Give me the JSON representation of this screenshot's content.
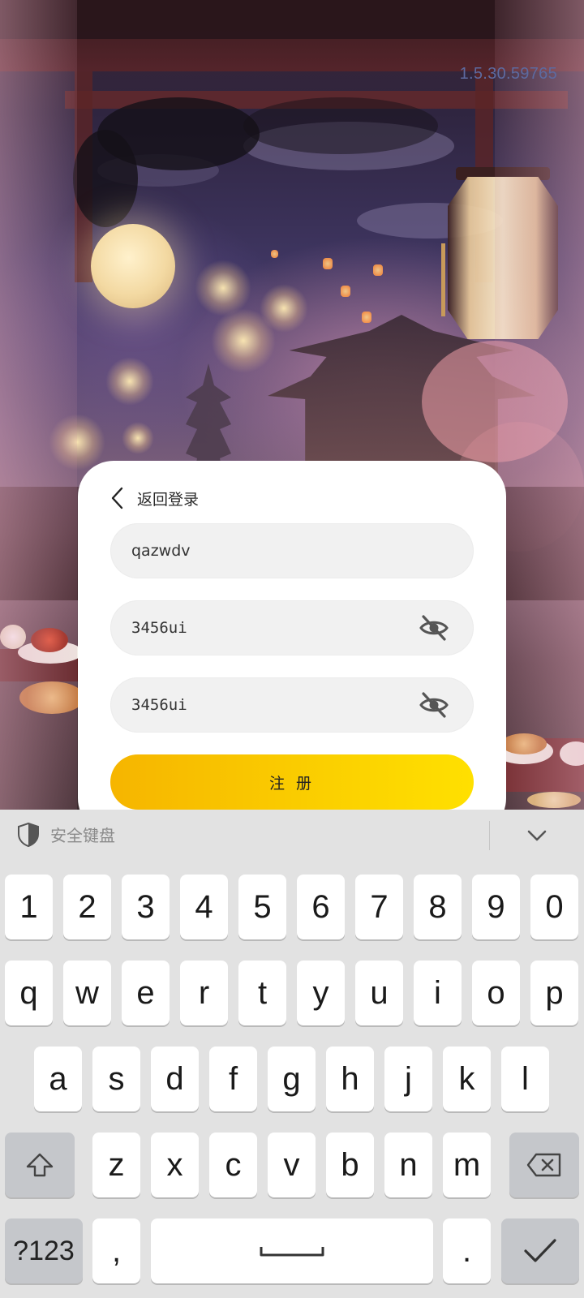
{
  "app": {
    "version": "1.5.30.59765"
  },
  "register_form": {
    "back_label": "返回登录",
    "username_value": "qazwdv",
    "password_value": "3456ui",
    "confirm_password_value": "3456ui",
    "register_button_label": "注 册"
  },
  "keyboard": {
    "title": "安全键盘",
    "row_numbers": [
      "1",
      "2",
      "3",
      "4",
      "5",
      "6",
      "7",
      "8",
      "9",
      "0"
    ],
    "row_top": [
      "q",
      "w",
      "e",
      "r",
      "t",
      "y",
      "u",
      "i",
      "o",
      "p"
    ],
    "row_middle": [
      "a",
      "s",
      "d",
      "f",
      "g",
      "h",
      "j",
      "k",
      "l"
    ],
    "row_bottom": [
      "z",
      "x",
      "c",
      "v",
      "b",
      "n",
      "m"
    ],
    "symbols_key": "?123",
    "comma_key": ",",
    "period_key": "."
  },
  "colors": {
    "button_gradient_start": "#f6b500",
    "button_gradient_end": "#ffe000",
    "version_text": "#5d6aa0"
  }
}
